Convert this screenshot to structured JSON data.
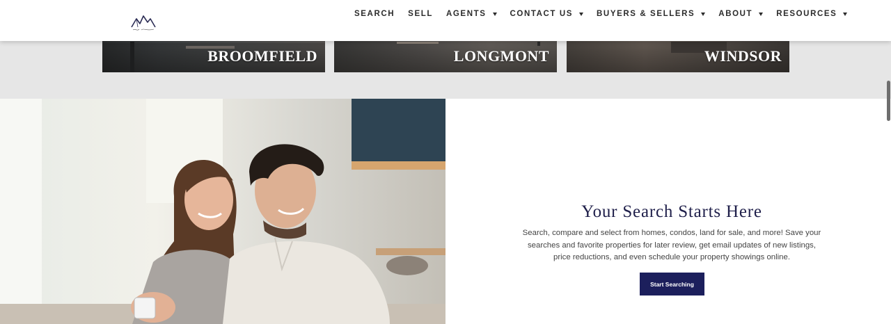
{
  "header": {
    "nav": [
      {
        "label": "SEARCH",
        "dropdown": false
      },
      {
        "label": "SELL",
        "dropdown": false
      },
      {
        "label": "AGENTS",
        "dropdown": true
      },
      {
        "label": "CONTACT US",
        "dropdown": true
      },
      {
        "label": "BUYERS & SELLERS",
        "dropdown": true
      },
      {
        "label": "ABOUT",
        "dropdown": true
      },
      {
        "label": "RESOURCES",
        "dropdown": true
      }
    ]
  },
  "cities": [
    {
      "name": "BROOMFIELD"
    },
    {
      "name": "LONGMONT"
    },
    {
      "name": "WINDSOR"
    }
  ],
  "promo": {
    "title": "Your Search Starts Here",
    "body": "Search, compare and select from homes, condos, land for sale, and more! Save your searches and favorite properties for later review, get email updates of new listings, price reductions, and even schedule your property showings online.",
    "button_label": "Start Searching"
  },
  "colors": {
    "accent": "#1c1f5c",
    "heading": "#1f1f4a",
    "nav_text": "#2b2b2b"
  },
  "icons": {
    "logo": "mountain-logo",
    "dropdown": "caret-down-icon"
  }
}
